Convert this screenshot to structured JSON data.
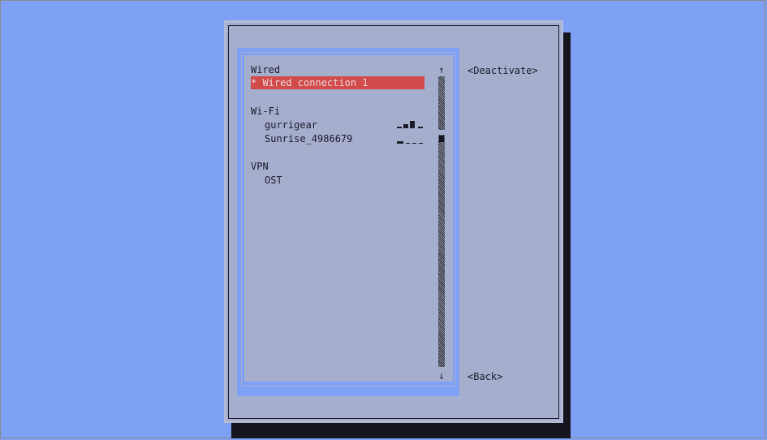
{
  "sections": [
    {
      "header": "Wired",
      "items": [
        {
          "label": "* Wired connection 1",
          "selected": true
        }
      ]
    },
    {
      "header": "Wi-Fi",
      "items": [
        {
          "label": "gurrigear",
          "signal_icon": "wifi-signal-strong-icon"
        },
        {
          "label": "Sunrise_4986679",
          "signal_icon": "wifi-signal-weak-icon"
        }
      ]
    },
    {
      "header": "VPN",
      "items": [
        {
          "label": "OST"
        }
      ]
    }
  ],
  "scroll": {
    "up_arrow": "↑",
    "down_arrow": "↓"
  },
  "buttons": {
    "deactivate": "<Deactivate>",
    "back": "<Back>"
  },
  "colors": {
    "desktop": "#7ea1f6",
    "dialog": "#a6aece",
    "selection": "#d14b4b",
    "shadow": "#15151d"
  }
}
